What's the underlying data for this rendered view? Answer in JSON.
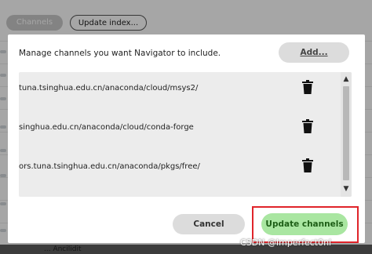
{
  "background": {
    "channels_label": "Channels",
    "update_index_label": "Update index...",
    "bottom_fragment": "... Ancilidit"
  },
  "dialog": {
    "description": "Manage channels you want Navigator to include.",
    "add_label": "Add...",
    "channels": [
      {
        "url": "tuna.tsinghua.edu.cn/anaconda/cloud/msys2/"
      },
      {
        "url": "singhua.edu.cn/anaconda/cloud/conda-forge"
      },
      {
        "url": "ors.tuna.tsinghua.edu.cn/anaconda/pkgs/free/"
      }
    ],
    "cancel_label": "Cancel",
    "update_label": "Update channels"
  },
  "watermark": "CSDN @Imperfect0nl",
  "colors": {
    "update_button_bg": "#a9e6a1",
    "highlight_frame": "#e0242a",
    "list_bg": "#ececec"
  },
  "icons": {
    "remove": "trash-icon",
    "scroll_up": "chevron-up-icon",
    "scroll_down": "chevron-down-icon"
  }
}
